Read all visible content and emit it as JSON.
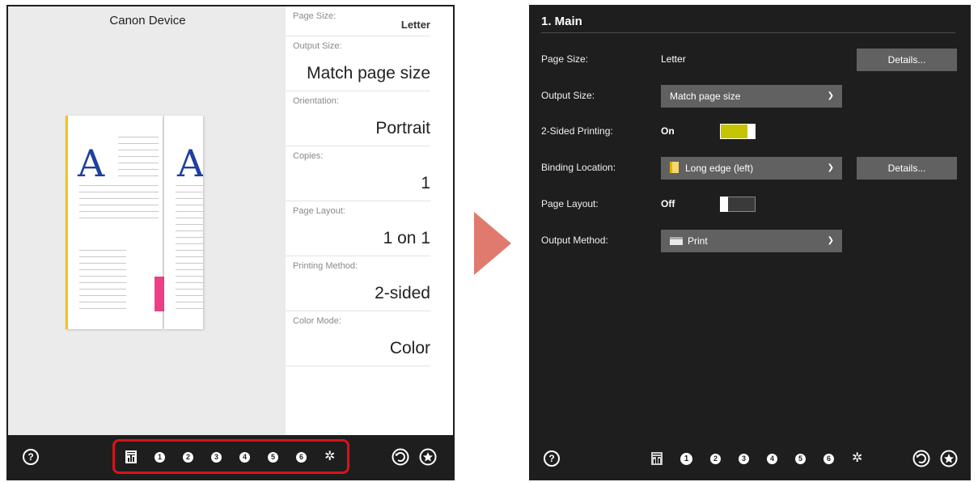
{
  "left_panel": {
    "device_title": "Canon Device",
    "preview": {
      "page_letter_front": "A",
      "page_letter_back": "A"
    },
    "settings": [
      {
        "label": "Page Size:",
        "value": "Letter"
      },
      {
        "label": "Output Size:",
        "value": "Match page size"
      },
      {
        "label": "Orientation:",
        "value": "Portrait"
      },
      {
        "label": "Copies:",
        "value": "1"
      },
      {
        "label": "Page Layout:",
        "value": "1 on 1"
      },
      {
        "label": "Printing Method:",
        "value": "2-sided"
      },
      {
        "label": "Color Mode:",
        "value": "Color"
      }
    ],
    "bottom_bar": {
      "help_glyph": "?",
      "tabs": [
        "1",
        "2",
        "3",
        "4",
        "5",
        "6"
      ],
      "highlight_color": "#d6141c"
    }
  },
  "right_panel": {
    "section_title": "1. Main",
    "rows": {
      "page_size": {
        "label": "Page Size:",
        "value": "Letter",
        "button": "Details..."
      },
      "output_size": {
        "label": "Output Size:",
        "value": "Match page size"
      },
      "two_sided": {
        "label": "2-Sided Printing:",
        "state": "On",
        "toggle_color": "#c4c400"
      },
      "binding": {
        "label": "Binding Location:",
        "value": "Long edge (left)",
        "button": "Details..."
      },
      "page_layout": {
        "label": "Page Layout:",
        "state": "Off"
      },
      "output_method": {
        "label": "Output Method:",
        "value": "Print"
      }
    },
    "bottom_bar": {
      "help_glyph": "?",
      "tabs": [
        "1",
        "2",
        "3",
        "4",
        "5",
        "6"
      ],
      "active_tab": "1"
    }
  },
  "colors": {
    "arrow": "#e07a6e",
    "dark_bg": "#1e1e1e",
    "dropdown_bg": "#616161"
  },
  "icons": [
    "help-icon",
    "document-summary-icon",
    "gear-icon",
    "reset-icon",
    "favorite-icon",
    "chevron-down-icon",
    "printer-icon",
    "page-binding-icon"
  ]
}
